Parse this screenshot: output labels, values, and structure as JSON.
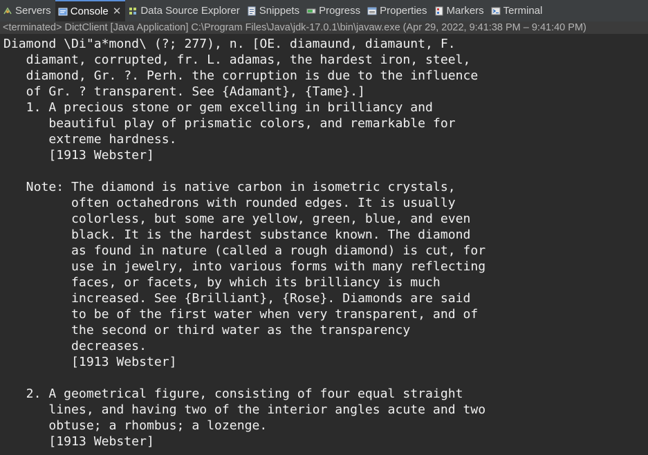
{
  "colors": {
    "tab_bar_bg": "#3c3f41",
    "console_bg": "#2b2b2b",
    "console_text": "#f0f0f0",
    "active_tab_accent": "#5a8fd8"
  },
  "tabs": [
    {
      "label": "Servers",
      "icon": "servers-icon",
      "active": false
    },
    {
      "label": "Console",
      "icon": "console-icon",
      "active": true
    },
    {
      "label": "Data Source Explorer",
      "icon": "data-source-icon",
      "active": false
    },
    {
      "label": "Snippets",
      "icon": "snippets-icon",
      "active": false
    },
    {
      "label": "Progress",
      "icon": "progress-icon",
      "active": false
    },
    {
      "label": "Properties",
      "icon": "properties-icon",
      "active": false
    },
    {
      "label": "Markers",
      "icon": "markers-icon",
      "active": false
    },
    {
      "label": "Terminal",
      "icon": "terminal-icon",
      "active": false
    }
  ],
  "console": {
    "status": "<terminated> DictClient [Java Application] C:\\Program Files\\Java\\jdk-17.0.1\\bin\\javaw.exe  (Apr 29, 2022, 9:41:38 PM – 9:41:40 PM)",
    "output": "Diamond \\Di\"a*mond\\ (?; 277), n. [OE. diamaund, diamaunt, F.\n   diamant, corrupted, fr. L. adamas, the hardest iron, steel,\n   diamond, Gr. ?. Perh. the corruption is due to the influence\n   of Gr. ? transparent. See {Adamant}, {Tame}.]\n   1. A precious stone or gem excelling in brilliancy and\n      beautiful play of prismatic colors, and remarkable for\n      extreme hardness.\n      [1913 Webster]\n\n   Note: The diamond is native carbon in isometric crystals,\n         often octahedrons with rounded edges. It is usually\n         colorless, but some are yellow, green, blue, and even\n         black. It is the hardest substance known. The diamond\n         as found in nature (called a rough diamond) is cut, for\n         use in jewelry, into various forms with many reflecting\n         faces, or facets, by which its brilliancy is much\n         increased. See {Brilliant}, {Rose}. Diamonds are said\n         to be of the first water when very transparent, and of\n         the second or third water as the transparency\n         decreases.\n         [1913 Webster]\n\n   2. A geometrical figure, consisting of four equal straight\n      lines, and having two of the interior angles acute and two\n      obtuse; a rhombus; a lozenge.\n      [1913 Webster]"
  }
}
